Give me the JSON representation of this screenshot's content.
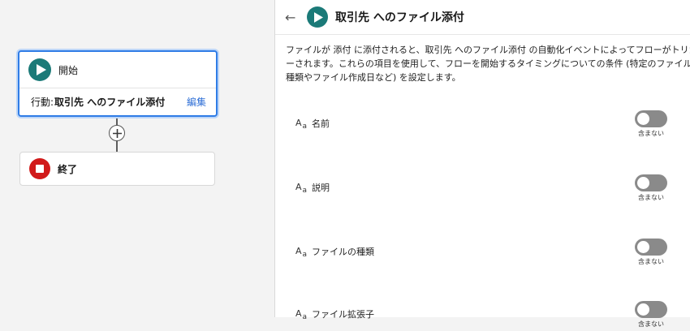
{
  "flow": {
    "start_card": {
      "title": "開始",
      "action_prefix": "行動:",
      "action_name": "取引先 へのファイル添付",
      "edit_label": "編集"
    },
    "add_step_icon": "plus-icon",
    "end_card": {
      "title": "終了"
    }
  },
  "panel": {
    "back_icon": "arrow-left-icon",
    "title": "取引先 へのファイル添付",
    "description": "ファイルが 添付 に添付されると、取引先 へのファイル添付 の自動化イベントによってフローがトリガ\nーされます。これらの項目を使用して、フローを開始するタイミングについての条件 (特定のファイル\n種類やファイル作成日など) を設定します。",
    "text_icon_big": "A",
    "text_icon_small": "a",
    "fields": [
      {
        "name": "名前",
        "toggle_caption": "含まない",
        "toggle_on": false
      },
      {
        "name": "説明",
        "toggle_caption": "含まない",
        "toggle_on": false
      },
      {
        "name": "ファイルの種類",
        "toggle_caption": "含まない",
        "toggle_on": false
      },
      {
        "name": "ファイル拡張子",
        "toggle_caption": "含まない",
        "toggle_on": false
      }
    ]
  },
  "colors": {
    "accent_blue": "#2f7ce6",
    "start_teal": "#1b7a78",
    "end_red": "#d11a1a",
    "toggle_off": "#8a8a8a"
  }
}
